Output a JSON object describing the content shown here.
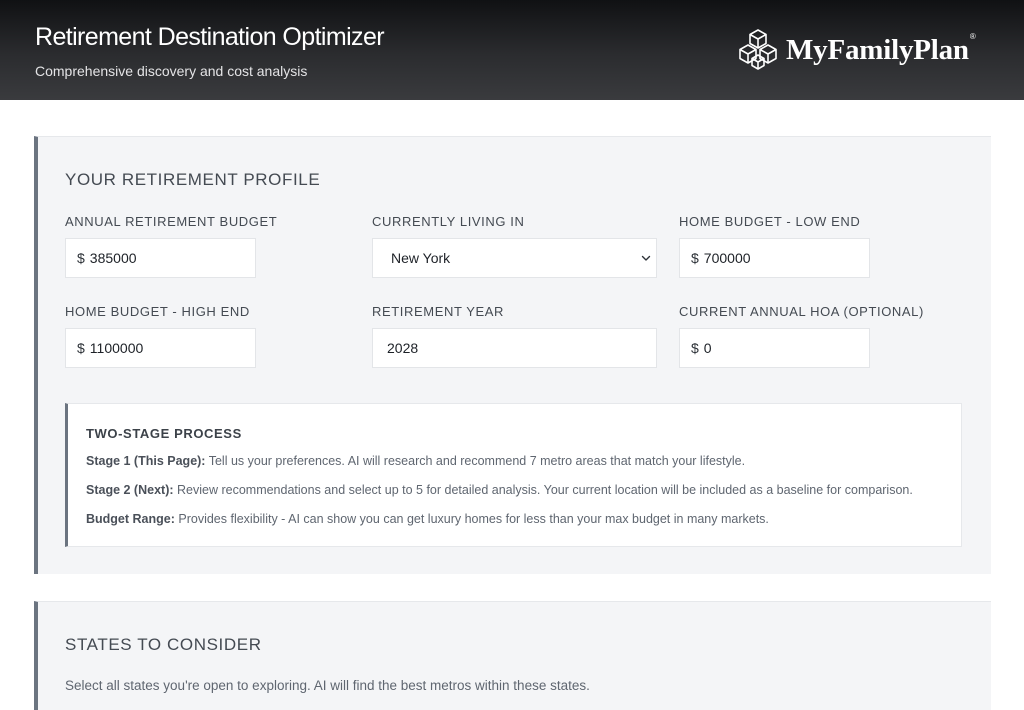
{
  "header": {
    "title": "Retirement Destination Optimizer",
    "subtitle": "Comprehensive discovery and cost analysis",
    "brand_name": "MyFamilyPlan",
    "brand_mark": "®",
    "logo_icon": "hexagon-cubes-logo-icon"
  },
  "profile": {
    "section_title": "YOUR RETIREMENT PROFILE",
    "annual_budget": {
      "label": "ANNUAL RETIREMENT BUDGET",
      "prefix": "$",
      "value": "385000"
    },
    "living_in": {
      "label": "CURRENTLY LIVING IN",
      "value": "New York"
    },
    "home_low": {
      "label": "HOME BUDGET - LOW END",
      "prefix": "$",
      "value": "700000"
    },
    "home_high": {
      "label": "HOME BUDGET - HIGH END",
      "prefix": "$",
      "value": "1100000"
    },
    "retirement_year": {
      "label": "RETIREMENT YEAR",
      "value": "2028"
    },
    "hoa": {
      "label": "CURRENT ANNUAL HOA (OPTIONAL)",
      "prefix": "$",
      "value": "0"
    }
  },
  "info": {
    "title": "TWO-STAGE PROCESS",
    "stage1_label": "Stage 1 (This Page):",
    "stage1_text": " Tell us your preferences. AI will research and recommend 7 metro areas that match your lifestyle.",
    "stage2_label": "Stage 2 (Next):",
    "stage2_text": " Review recommendations and select up to 5 for detailed analysis. Your current location will be included as a baseline for comparison.",
    "budget_label": "Budget Range:",
    "budget_text": " Provides flexibility - AI can show you can get luxury homes for less than your max budget in many markets."
  },
  "states": {
    "section_title": "STATES TO CONSIDER",
    "description": "Select all states you're open to exploring. AI will find the best metros within these states."
  },
  "colors": {
    "header_bg": "#1c1d20",
    "card_bg": "#f4f5f7",
    "accent_border": "#6b7480"
  }
}
